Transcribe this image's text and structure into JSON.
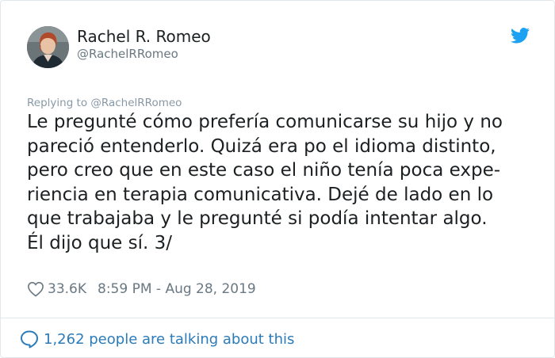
{
  "author": {
    "display_name": "Rachel R. Romeo",
    "handle": "@RachelRRomeo"
  },
  "reply": {
    "label": "Replying to @RachelRRomeo"
  },
  "tweet": {
    "lines": [
      "Le pregunté cómo prefería comunicarse su hijo y no",
      "pareció entenderlo. Quizá era po el idioma distinto,",
      "pero creo que en este caso el niño tenía poca expe-",
      "riencia en terapia comunicativa. Dejé de lado en lo",
      "que trabajaba y le pregunté si podía intentar algo.",
      "Él dijo que sí. 3/"
    ]
  },
  "meta": {
    "likes": "33.6K",
    "timestamp": "8:59 PM - Aug 28, 2019"
  },
  "footer": {
    "talking_label": "1,262 people are talking about this"
  },
  "icons": {
    "brand": "twitter-bird-icon",
    "like": "heart-icon",
    "conversation": "speech-bubble-icon"
  },
  "colors": {
    "twitter_blue": "#1da1f2",
    "link_blue": "#2b7bb9",
    "secondary_text": "#697882",
    "divider": "#e1e8ed"
  }
}
